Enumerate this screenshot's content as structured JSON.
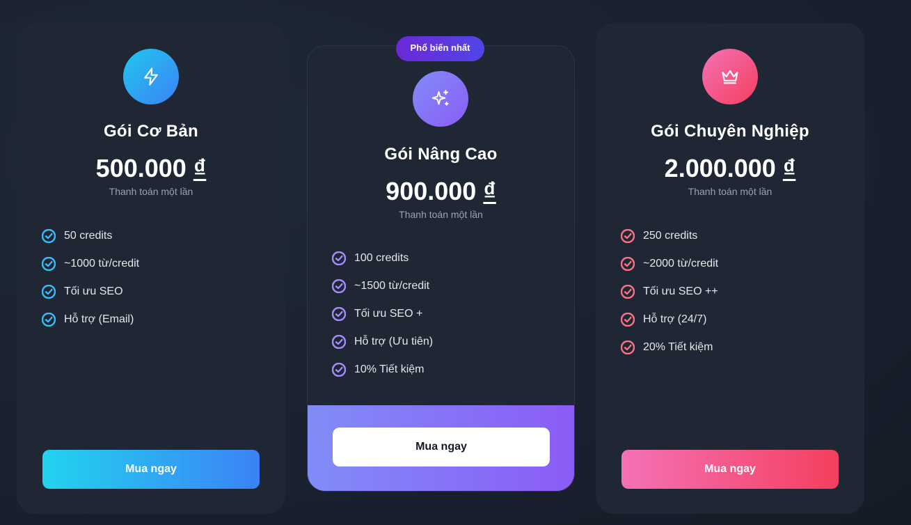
{
  "badge": "Phổ biến nhất",
  "plans": [
    {
      "icon": "lightning-icon",
      "title": "Gói Cơ Bản",
      "price": "500.000",
      "currency": "₫",
      "note": "Thanh toán một lần",
      "features": [
        "50 credits",
        "~1000 từ/credit",
        "Tối ưu SEO",
        "Hỗ trợ (Email)"
      ],
      "button": "Mua ngay",
      "accent": "#38bdf8"
    },
    {
      "icon": "sparkles-icon",
      "title": "Gói Nâng Cao",
      "price": "900.000",
      "currency": "₫",
      "note": "Thanh toán một lần",
      "features": [
        "100 credits",
        "~1500 từ/credit",
        "Tối ưu SEO +",
        "Hỗ trợ (Ưu tiên)",
        "10% Tiết kiệm"
      ],
      "button": "Mua ngay",
      "accent": "#8b5cf6"
    },
    {
      "icon": "crown-icon",
      "title": "Gói Chuyên Nghiệp",
      "price": "2.000.000",
      "currency": "₫",
      "note": "Thanh toán một lần",
      "features": [
        "250 credits",
        "~2000 từ/credit",
        "Tối ưu SEO ++",
        "Hỗ trợ (24/7)",
        "20% Tiết kiệm"
      ],
      "button": "Mua ngay",
      "accent": "#f43f5e"
    }
  ]
}
